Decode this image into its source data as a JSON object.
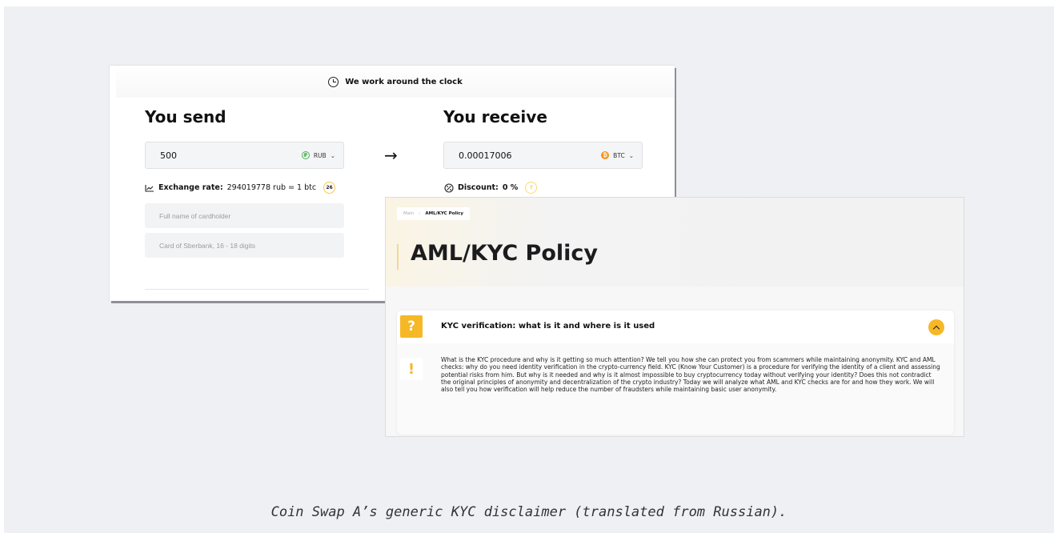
{
  "exchange": {
    "notice": "We work around the clock",
    "send": {
      "title": "You send",
      "amount": "500",
      "currency": "RUB",
      "currency_icon": "ruble-icon",
      "name_placeholder": "Full name of cardholder",
      "card_placeholder": "Card of Sberbank, 16 - 18 digits"
    },
    "receive": {
      "title": "You receive",
      "amount": "0.00017006",
      "currency": "BTC",
      "currency_icon": "bitcoin-icon"
    },
    "arrow": "→",
    "rate_label": "Exchange rate:",
    "rate_value": "294019778 rub = 1 btc",
    "rate_badge": "26",
    "discount_label": "Discount:",
    "discount_value": "0 %",
    "discount_badge": "?"
  },
  "policy": {
    "breadcrumb": [
      "Main",
      "AML/KYC Policy"
    ],
    "breadcrumb_sep": "›",
    "title": "AML/KYC Policy",
    "accordion": {
      "question_icon": "?",
      "title": "KYC verification: what is it and where is it used",
      "expanded": true,
      "body_icon": "!",
      "body": "What is the KYC procedure and why is it getting so much attention? We tell you how she can protect you from scammers while maintaining anonymity. KYC and AML checks: why do you need identity verification in the crypto-currency field. KYC (Know Your Customer) is a procedure for verifying the identity of a client and assessing potential risks from him. But why is it needed and why is it almost impossible to buy cryptocurrency today without verifying your identity? Does this not contradict the original principles of anonymity and decentralization of the crypto industry? Today we will analyze what AML and KYC checks are for and how they work. We will also tell you how verification will help reduce the number of fraudsters while maintaining basic user anonymity."
    }
  },
  "caption": "Coin Swap A’s generic KYC disclaimer (translated from Russian).",
  "colors": {
    "accent": "#f6b826",
    "rub_green": "#49b34c",
    "btc_orange": "#f7931a",
    "background": "#eef0f4"
  }
}
